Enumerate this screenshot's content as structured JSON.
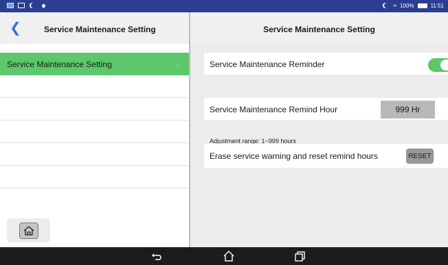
{
  "status_bar": {
    "battery_percent": "100%",
    "time": "11:51"
  },
  "left": {
    "title": "Service Maintenance Setting",
    "items": [
      {
        "label": "Service Maintenance Setting",
        "active": true
      },
      {
        "label": ""
      },
      {
        "label": ""
      },
      {
        "label": ""
      },
      {
        "label": ""
      },
      {
        "label": ""
      }
    ]
  },
  "right": {
    "title": "Service Maintenance Setting",
    "reminder_label": "Service Maintenance Reminder",
    "reminder_enabled": true,
    "remind_hour_label": "Service Maintenance Remind Hour",
    "remind_hour_value": "999 Hr",
    "adjustment_hint": "Adjustment range: 1~999 hours",
    "erase_label": "Erase service warning and reset remind hours",
    "reset_button": "RESET"
  },
  "colors": {
    "status_bar": "#2c3e91",
    "accent_green": "#5cc86b",
    "back_arrow": "#3a6fd8"
  },
  "icons": [
    "gallery-icon",
    "message-icon",
    "moon-icon",
    "location-icon",
    "wifi-icon",
    "battery-icon",
    "back-arrow-icon",
    "home-icon",
    "nav-back-icon",
    "nav-home-icon",
    "nav-recents-icon"
  ]
}
